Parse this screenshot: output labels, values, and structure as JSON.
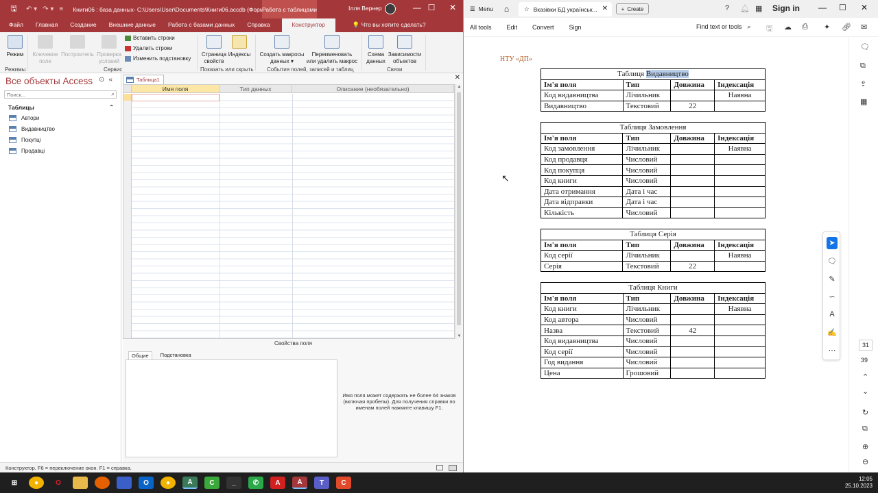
{
  "access": {
    "title": "Книги06 : база данных- C:\\Users\\User\\Documents\\Книги06.accdb (Форм...",
    "context_tab": "Работа с таблицами",
    "user": "Ілля Вернер",
    "tabs": [
      "Файл",
      "Главная",
      "Создание",
      "Внешние данные",
      "Работа с базами данных",
      "Справка",
      "Конструктор"
    ],
    "active_tab": "Конструктор",
    "tell_me": "Что вы хотите сделать?",
    "ribbon": {
      "mode": "Режим",
      "key_field_1": "Ключевое",
      "key_field_2": "поле",
      "builder": "Построитель",
      "validate_1": "Проверка",
      "validate_2": "условий",
      "insert_rows": "Вставить строки",
      "delete_rows": "Удалить строки",
      "change_lookup": "Изменить подстановку",
      "prop_sheet_1": "Страница",
      "prop_sheet_2": "свойств",
      "indexes": "Индексы",
      "create_macros_1": "Создать макросы",
      "create_macros_2": "данных ▾",
      "rename_macro_1": "Переименовать",
      "rename_macro_2": "или удалить макрос",
      "relationships_1": "Схема",
      "relationships_2": "данных",
      "dependencies_1": "Зависимости",
      "dependencies_2": "объектов",
      "groups": [
        "Режимы",
        "Сервис",
        "Показать или скрыть",
        "События полей, записей и таблиц",
        "Связи"
      ]
    },
    "nav": {
      "title": "Все объекты Access",
      "search_placeholder": "Поиск...",
      "category": "Таблицы",
      "items": [
        "Автори",
        "Видавництво",
        "Покупці",
        "Продавці"
      ]
    },
    "doc_tab": "Таблица1",
    "grid_headers": [
      "Имя поля",
      "Тип данных",
      "Описание (необязательно)"
    ],
    "field_props_title": "Свойства поля",
    "prop_tabs": [
      "Общие",
      "Подстановка"
    ],
    "help_text": "Имя поля может содержать не более 64 знаков (включая пробелы). Для получения справки по именам полей нажмите клавишу F1.",
    "status": "Конструктор.  F6 = переключение окон.  F1 = справка."
  },
  "pdf": {
    "menu": "Menu",
    "tab_title": "Вказівки БД українськ...",
    "create": "Create",
    "sign_in": "Sign in",
    "tools": [
      "All tools",
      "Edit",
      "Convert",
      "Sign"
    ],
    "find": "Find text or tools",
    "header": "НТУ «ДП»",
    "col_headers": [
      "Ім'я поля",
      "Тип",
      "Довжина",
      "Індексація"
    ],
    "tables": [
      {
        "caption_pre": "Таблиця ",
        "caption_hl": "Видавництво",
        "rows": [
          [
            "Код видавництва",
            "Лічильник",
            "",
            "Наявна"
          ],
          [
            "Видавництво",
            "Текстовий",
            "22",
            ""
          ]
        ]
      },
      {
        "caption_pre": "Таблиця Замовлення",
        "caption_hl": "",
        "rows": [
          [
            "Код замовлення",
            "Лічильник",
            "",
            "Наявна"
          ],
          [
            "Код продавця",
            "Числовий",
            "",
            ""
          ],
          [
            "Код покупця",
            "Числовий",
            "",
            ""
          ],
          [
            "Код книги",
            "Числовий",
            "",
            ""
          ],
          [
            "Дата отримання",
            "Дата і час",
            "",
            ""
          ],
          [
            "Дата відправки",
            "Дата і час",
            "",
            ""
          ],
          [
            "Кількість",
            "Числовий",
            "",
            ""
          ]
        ]
      },
      {
        "caption_pre": "Таблиця Серія",
        "caption_hl": "",
        "rows": [
          [
            "Код серії",
            "Лічильник",
            "",
            "Наявна"
          ],
          [
            "Серія",
            "Текстовий",
            "22",
            ""
          ]
        ]
      },
      {
        "caption_pre": "Таблиця Книги",
        "caption_hl": "",
        "rows": [
          [
            "Код книги",
            "Лічильник",
            "",
            "Наявна"
          ],
          [
            "Код автора",
            "Числовий",
            "",
            ""
          ],
          [
            "Назва",
            "Текстовий",
            "42",
            ""
          ],
          [
            "Код видавництва",
            "Числовий",
            "",
            ""
          ],
          [
            "Код серії",
            "Числовий",
            "",
            ""
          ],
          [
            "Год видання",
            "Числовий",
            "",
            ""
          ],
          [
            "Цена",
            "Грошовий",
            "",
            ""
          ]
        ]
      }
    ],
    "page_current": "31",
    "page_total": "39"
  },
  "taskbar": {
    "time": "12:05",
    "date": "25.10.2023"
  }
}
